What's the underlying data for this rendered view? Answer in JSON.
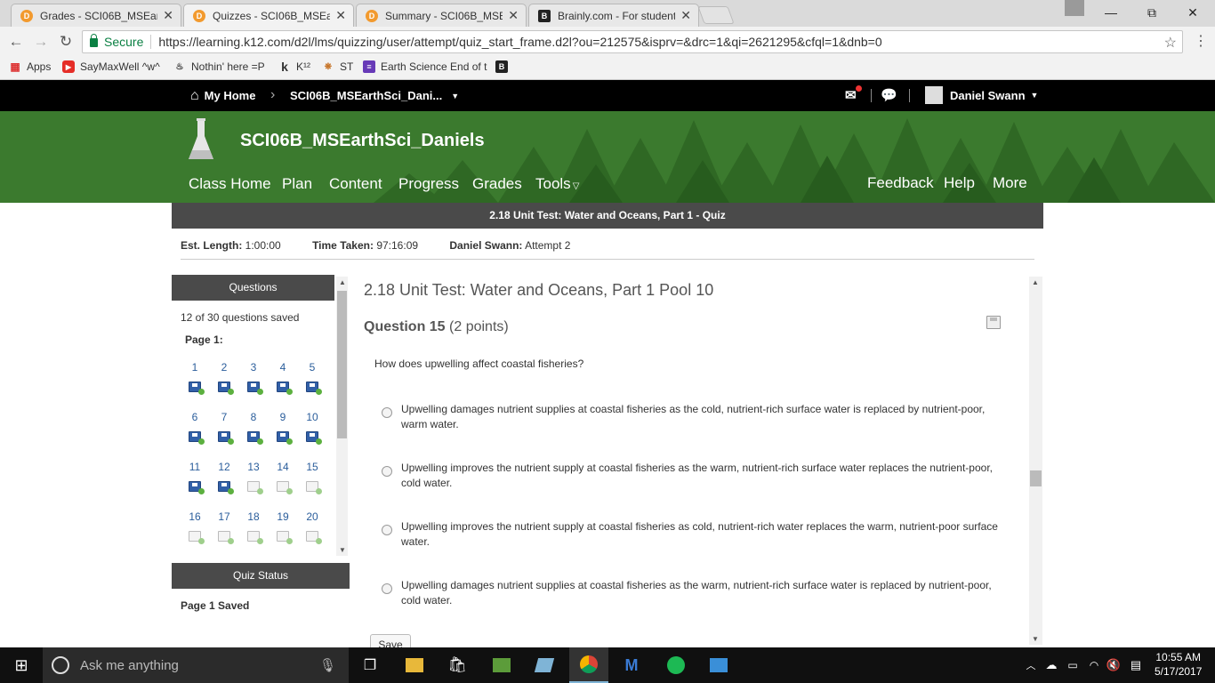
{
  "browser": {
    "tabs": [
      {
        "title": "Grades - SCI06B_MSEarthSci",
        "icon": "d2l-icon"
      },
      {
        "title": "Quizzes - SCI06B_MSEarthSci",
        "icon": "d2l-icon"
      },
      {
        "title": "Summary - SCI06B_MSEarthSci",
        "icon": "d2l-icon"
      },
      {
        "title": "Brainly.com - For students",
        "icon": "brainly-icon"
      }
    ],
    "secure_label": "Secure",
    "url": "https://learning.k12.com/d2l/lms/quizzing/user/attempt/quiz_start_frame.d2l?ou=212575&isprv=&drc=1&qi=2621295&cfql=1&dnb=0",
    "bookmarks": [
      "Apps",
      "SayMaxWell ^w^",
      "Nothin' here =P",
      "K¹²",
      "ST",
      "Earth Science End of t"
    ]
  },
  "topnav": {
    "home": "My Home",
    "course": "SCI06B_MSEarthSci_Dani...",
    "user": "Daniel Swann"
  },
  "banner": {
    "course_title": "SCI06B_MSEarthSci_Daniels",
    "nav_left": [
      "Class Home",
      "Plan",
      "Content",
      "Progress",
      "Grades",
      "Tools"
    ],
    "nav_right": [
      "Feedback",
      "Help",
      "More"
    ]
  },
  "quiz": {
    "title": "2.18 Unit Test: Water and Oceans, Part 1 - Quiz",
    "est_length_label": "Est. Length:",
    "est_length": "1:00:00",
    "time_taken_label": "Time Taken:",
    "time_taken": "97:16:09",
    "student_label": "Daniel Swann:",
    "attempt": "Attempt 2"
  },
  "questions_panel": {
    "header": "Questions",
    "saved_count": "12 of 30 questions saved",
    "page_label": "Page 1:",
    "questions": [
      {
        "n": "1",
        "saved": true
      },
      {
        "n": "2",
        "saved": true
      },
      {
        "n": "3",
        "saved": true
      },
      {
        "n": "4",
        "saved": true
      },
      {
        "n": "5",
        "saved": true
      },
      {
        "n": "6",
        "saved": true
      },
      {
        "n": "7",
        "saved": true
      },
      {
        "n": "8",
        "saved": true
      },
      {
        "n": "9",
        "saved": true
      },
      {
        "n": "10",
        "saved": true
      },
      {
        "n": "11",
        "saved": true
      },
      {
        "n": "12",
        "saved": true
      },
      {
        "n": "13",
        "saved": false
      },
      {
        "n": "14",
        "saved": false
      },
      {
        "n": "15",
        "saved": false
      },
      {
        "n": "16",
        "saved": false
      },
      {
        "n": "17",
        "saved": false
      },
      {
        "n": "18",
        "saved": false
      },
      {
        "n": "19",
        "saved": false
      },
      {
        "n": "20",
        "saved": false
      }
    ]
  },
  "quiz_status": {
    "header": "Quiz Status",
    "page_saved": "Page 1 Saved"
  },
  "content": {
    "section_title": "2.18 Unit Test: Water and Oceans, Part 1 Pool 10",
    "question_label": "Question 15",
    "points": "(2 points)",
    "prompt": "How does upwelling affect coastal fisheries?",
    "choices": [
      "Upwelling damages nutrient supplies at coastal fisheries as the cold, nutrient-rich surface water is replaced by nutrient-poor, warm water.",
      "Upwelling improves the nutrient supply at coastal fisheries as the warm, nutrient-rich surface water replaces the nutrient-poor, cold water.",
      "Upwelling improves the nutrient supply at coastal fisheries as cold, nutrient-rich water replaces the warm, nutrient-poor surface water.",
      "Upwelling damages nutrient supplies at coastal fisheries as the warm, nutrient-rich surface water is replaced by nutrient-poor, cold water."
    ],
    "save_label": "Save"
  },
  "taskbar": {
    "search_placeholder": "Ask me anything",
    "time": "10:55 AM",
    "date": "5/17/2017"
  }
}
